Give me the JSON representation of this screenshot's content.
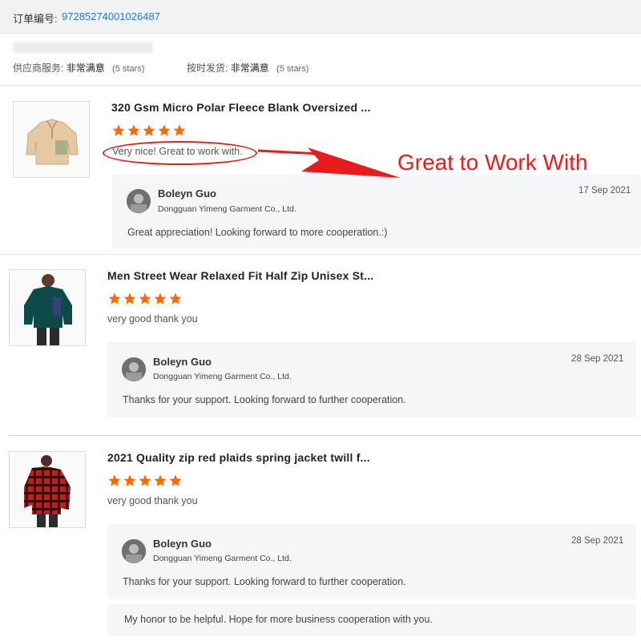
{
  "order": {
    "label": "订单编号:",
    "number": "97285274001026487"
  },
  "supplier_ratings": [
    {
      "label": "供应商服务:",
      "value": "非常满意",
      "stars": "(5 stars)"
    },
    {
      "label": "按时发货:",
      "value": "非常满意",
      "stars": "(5 stars)"
    }
  ],
  "callout": {
    "text": "Great to Work With",
    "color": "#ee1a1a"
  },
  "star_color": "#ff6a00",
  "reviews": [
    {
      "title": "320 Gsm Micro Polar Fleece Blank Oversized ...",
      "rating": 5,
      "comment": "Very nice! Great to work with.",
      "reply": {
        "name": "Boleyn Guo",
        "company": "Dongguan Yimeng Garment Co., Ltd.",
        "date": "17 Sep 2021",
        "message": "Great appreciation! Looking forward to more cooperation.:)"
      }
    },
    {
      "title": "Men Street Wear Relaxed Fit Half Zip Unisex St...",
      "rating": 5,
      "comment": "very good thank you",
      "reply": {
        "name": "Boleyn Guo",
        "company": "Dongguan Yimeng Garment Co., Ltd.",
        "date": "28 Sep 2021",
        "message": "Thanks for your support. Looking forward to further cooperation."
      }
    },
    {
      "title": "2021 Quality zip red plaids spring jacket twill f...",
      "rating": 5,
      "comment": "very good thank you",
      "reply": {
        "name": "Boleyn Guo",
        "company": "Dongguan Yimeng Garment Co., Ltd.",
        "date": "28 Sep 2021",
        "message": "Thanks for your support. Looking forward to further cooperation."
      },
      "followup": "My honor to be helpful. Hope for more business cooperation with you."
    }
  ]
}
